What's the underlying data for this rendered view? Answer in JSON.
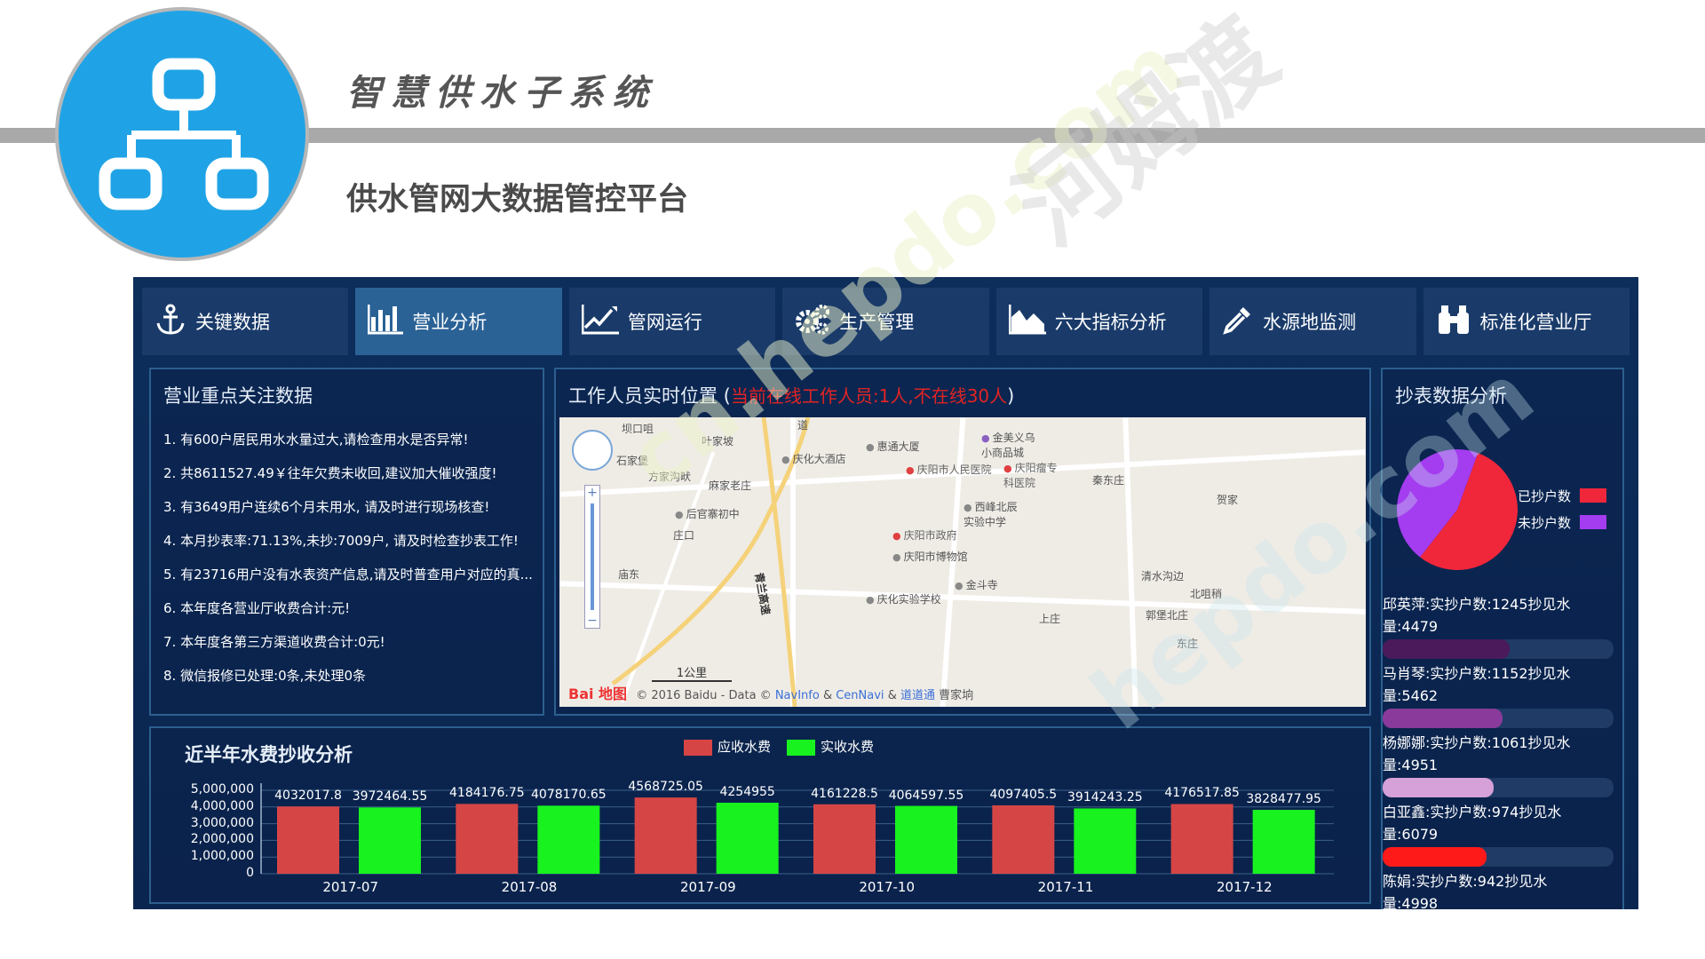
{
  "header": {
    "system_title": "智慧供水子系统",
    "platform_title": "供水管网大数据管控平台"
  },
  "nav": {
    "items": [
      {
        "label": "关键数据",
        "icon": "anchor-icon",
        "active": false
      },
      {
        "label": "营业分析",
        "icon": "bar-chart-icon",
        "active": true
      },
      {
        "label": "管网运行",
        "icon": "line-chart-icon",
        "active": false
      },
      {
        "label": "生产管理",
        "icon": "gears-icon",
        "active": false
      },
      {
        "label": "六大指标分析",
        "icon": "area-chart-icon",
        "active": false
      },
      {
        "label": "水源地监测",
        "icon": "eyedropper-icon",
        "active": false
      },
      {
        "label": "标准化营业厅",
        "icon": "binoculars-icon",
        "active": false
      }
    ]
  },
  "focus_panel": {
    "title": "营业重点关注数据",
    "items": [
      "1. 有600户居民用水水量过大,请检查用水是否异常!",
      "2. 共8611527.49￥往年欠费未收回,建议加大催收强度!",
      "3. 有3649用户连续6个月未用水, 请及时进行现场核查!",
      "4. 本月抄表率:71.13%,未抄:7009户, 请及时检查抄表工作!",
      "5. 有23716用户没有水表资产信息,请及时普查用户对应的真...",
      "6. 本年度各营业厅收费合计:元!",
      "7. 本年度各第三方渠道收费合计:0元!",
      "8. 微信报修已处理:0条,未处理0条"
    ]
  },
  "map_panel": {
    "title_prefix": "工作人员实时位置 (",
    "title_highlight": "当前在线工作人员:1人,不在线30人",
    "title_suffix": ")",
    "pois": [
      {
        "label": "坝口咀",
        "type": "plain"
      },
      {
        "label": "叶家坡",
        "type": "plain"
      },
      {
        "label": "石家堡",
        "type": "plain"
      },
      {
        "label": "方家沟畎",
        "type": "plain"
      },
      {
        "label": "庆化大酒店",
        "type": "gray"
      },
      {
        "label": "惠通大厦",
        "type": "gray"
      },
      {
        "label": "金美义乌小商品城",
        "type": "purple"
      },
      {
        "label": "庆阳市人民医院",
        "type": "red"
      },
      {
        "label": "庆阳瘤专科医院",
        "type": "red"
      },
      {
        "label": "麻家老庄",
        "type": "plain"
      },
      {
        "label": "秦东庄",
        "type": "plain"
      },
      {
        "label": "后官寨初中",
        "type": "gray"
      },
      {
        "label": "西峰北辰实验中学",
        "type": "gray"
      },
      {
        "label": "庄口",
        "type": "plain"
      },
      {
        "label": "庆阳市政府",
        "type": "red"
      },
      {
        "label": "庆阳市博物馆",
        "type": "gray"
      },
      {
        "label": "庙东",
        "type": "plain"
      },
      {
        "label": "金斗寺",
        "type": "gray"
      },
      {
        "label": "清水沟边",
        "type": "plain"
      },
      {
        "label": "北咀稍",
        "type": "plain"
      },
      {
        "label": "庆化实验学校",
        "type": "gray"
      },
      {
        "label": "上庄",
        "type": "plain"
      },
      {
        "label": "郭堡北庄",
        "type": "plain"
      },
      {
        "label": "东庄",
        "type": "plain"
      },
      {
        "label": "贺家",
        "type": "plain"
      },
      {
        "label": "道",
        "type": "plain"
      },
      {
        "label": "青兰高速",
        "type": "plain"
      }
    ],
    "scale": "1公里",
    "footer_logo": "Bai 地图",
    "footer_copy": "© 2016 Baidu - Data ©",
    "footer_navinfo": "NavInfo",
    "footer_amp1": "&",
    "footer_cennavi": "CenNavi",
    "footer_amp2": "&",
    "footer_daodao": "道道通",
    "footer_extra": "曹家垧"
  },
  "meter_panel": {
    "title": "抄表数据分析",
    "pie": {
      "read_fraction": 0.55,
      "read_color": "#f0263b",
      "unread_color": "#a43cf0"
    },
    "legend": [
      {
        "label": "已抄户数",
        "color": "#f0263b"
      },
      {
        "label": "未抄户数",
        "color": "#a43cf0"
      }
    ],
    "entries": [
      {
        "line1": "邱英萍:实抄户数:1245抄见水",
        "line2": "量:4479",
        "fill": 0.55,
        "color": "#4a1a5a"
      },
      {
        "line1": "马肖琴:实抄户数:1152抄见水",
        "line2": "量:5462",
        "fill": 0.52,
        "color": "#8a3a9a"
      },
      {
        "line1": "杨娜娜:实抄户数:1061抄见水",
        "line2": "量:4951",
        "fill": 0.48,
        "color": "#d6a0d8"
      },
      {
        "line1": "白亚鑫:实抄户数:974抄见水",
        "line2": "量:6079",
        "fill": 0.45,
        "color": "#ff1a1a"
      },
      {
        "line1": "陈娟:实抄户数:942抄见水",
        "line2": "量:4998",
        "fill": 0.42,
        "color": "#ff1a1a"
      }
    ]
  },
  "chart_data": {
    "type": "bar",
    "title": "近半年水费抄收分析",
    "categories": [
      "2017-07",
      "2017-08",
      "2017-09",
      "2017-10",
      "2017-11",
      "2017-12"
    ],
    "series": [
      {
        "name": "应收水费",
        "color": "#d64545",
        "values": [
          4032017.8,
          4184176.75,
          4568725.05,
          4161228.5,
          4097405.5,
          4176517.85
        ],
        "labels": [
          "4032017.8",
          "4184176.75",
          "4568725.05",
          "4161228.5",
          "4097405.5",
          "4176517.85"
        ]
      },
      {
        "name": "实收水费",
        "color": "#18f21f",
        "values": [
          3972464.55,
          4078170.65,
          4254955,
          4064597.55,
          3914243.25,
          3828477.95
        ],
        "labels": [
          "3972464.55",
          "4078170.65",
          "4254955",
          "4064597.55",
          "3914243.25",
          "3828477.95"
        ]
      }
    ],
    "yticks": [
      "5,000,000",
      "4,000,000",
      "3,000,000",
      "2,000,000",
      "1,000,000",
      "0"
    ],
    "ylim": [
      0,
      5000000
    ],
    "grid": true
  }
}
